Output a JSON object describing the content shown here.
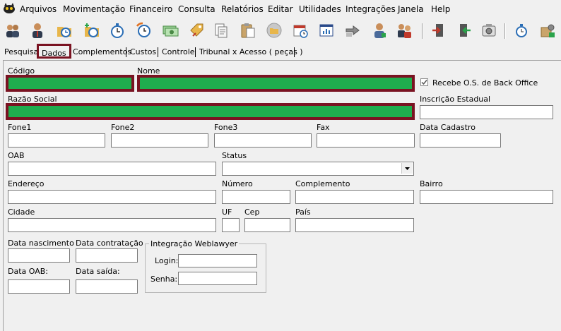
{
  "menu": [
    "Arquivos",
    "Movimentação",
    "Financeiro",
    "Consulta",
    "Relatórios",
    "Editar",
    "Utilidades",
    "Integrações",
    "Janela",
    "Help"
  ],
  "toolbar_icons": [
    "users-group-icon",
    "user-icon",
    "folder-clock-icon",
    "folder-add-clock-icon",
    "stopwatch-icon",
    "clock-cycle-icon",
    "money-icon",
    "tag-edit-icon",
    "clipboard-copy-icon",
    "clipboard-paste-icon",
    "folder-round-icon",
    "calendar-icon",
    "report-window-icon",
    "hand-arrow-icon",
    "user-badge-icon",
    "users-exchange-icon",
    "door-exit-icon",
    "door-enter-icon",
    "camera-icon",
    "stopwatch-small-icon",
    "box-settings-icon"
  ],
  "tabs": [
    "Pesquisa",
    "Dados",
    "Complementos",
    "Custos",
    "Controle",
    "Tribunal x Acesso ( peças )"
  ],
  "active_tab": "Dados",
  "colors": {
    "highlight_fill": "#1fad4e",
    "highlight_border": "#7a1322"
  },
  "form": {
    "codigo_label": "Código",
    "nome_label": "Nome",
    "recebe_os_label": "Recebe O.S. de Back Office",
    "recebe_os_checked": true,
    "razao_social_label": "Razão Social",
    "inscricao_estadual_label": "Inscrição Estadual",
    "fone1_label": "Fone1",
    "fone2_label": "Fone2",
    "fone3_label": "Fone3",
    "fax_label": "Fax",
    "data_cadastro_label": "Data Cadastro",
    "oab_label": "OAB",
    "status_label": "Status",
    "endereco_label": "Endereço",
    "numero_label": "Número",
    "complemento_label": "Complemento",
    "bairro_label": "Bairro",
    "cidade_label": "Cidade",
    "uf_label": "UF",
    "cep_label": "Cep",
    "pais_label": "País",
    "data_nascimento_label": "Data nascimento",
    "data_contratacao_label": "Data contratação",
    "data_oab_label": "Data OAB:",
    "data_saida_label": "Data saída:",
    "weblawyer_group_label": "Integração Weblawyer",
    "login_label": "Login:",
    "senha_label": "Senha:"
  }
}
